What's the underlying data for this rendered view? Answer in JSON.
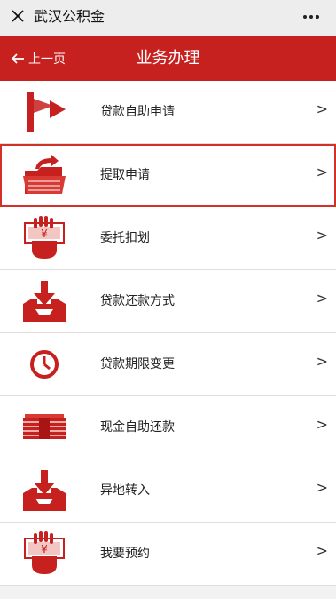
{
  "window": {
    "title": "武汉公积金"
  },
  "header": {
    "back_label": "上一页",
    "title": "业务办理"
  },
  "menu": {
    "items": [
      {
        "label": "贷款自助申请",
        "chevron": ">",
        "icon": "flag-icon"
      },
      {
        "label": "提取申请",
        "chevron": ">",
        "icon": "folder-icon",
        "selected": true
      },
      {
        "label": "委托扣划",
        "chevron": ">",
        "icon": "hand-money-icon"
      },
      {
        "label": "贷款还款方式",
        "chevron": ">",
        "icon": "inbox-download-icon"
      },
      {
        "label": "贷款期限变更",
        "chevron": ">",
        "icon": "clock-icon"
      },
      {
        "label": "现金自助还款",
        "chevron": ">",
        "icon": "cash-stack-icon"
      },
      {
        "label": "异地转入",
        "chevron": ">",
        "icon": "inbox-download-icon"
      },
      {
        "label": "我要预约",
        "chevron": ">",
        "icon": "hand-money-icon"
      }
    ]
  },
  "colors": {
    "accent": "#c6201f",
    "selected_border": "#d4302a"
  }
}
